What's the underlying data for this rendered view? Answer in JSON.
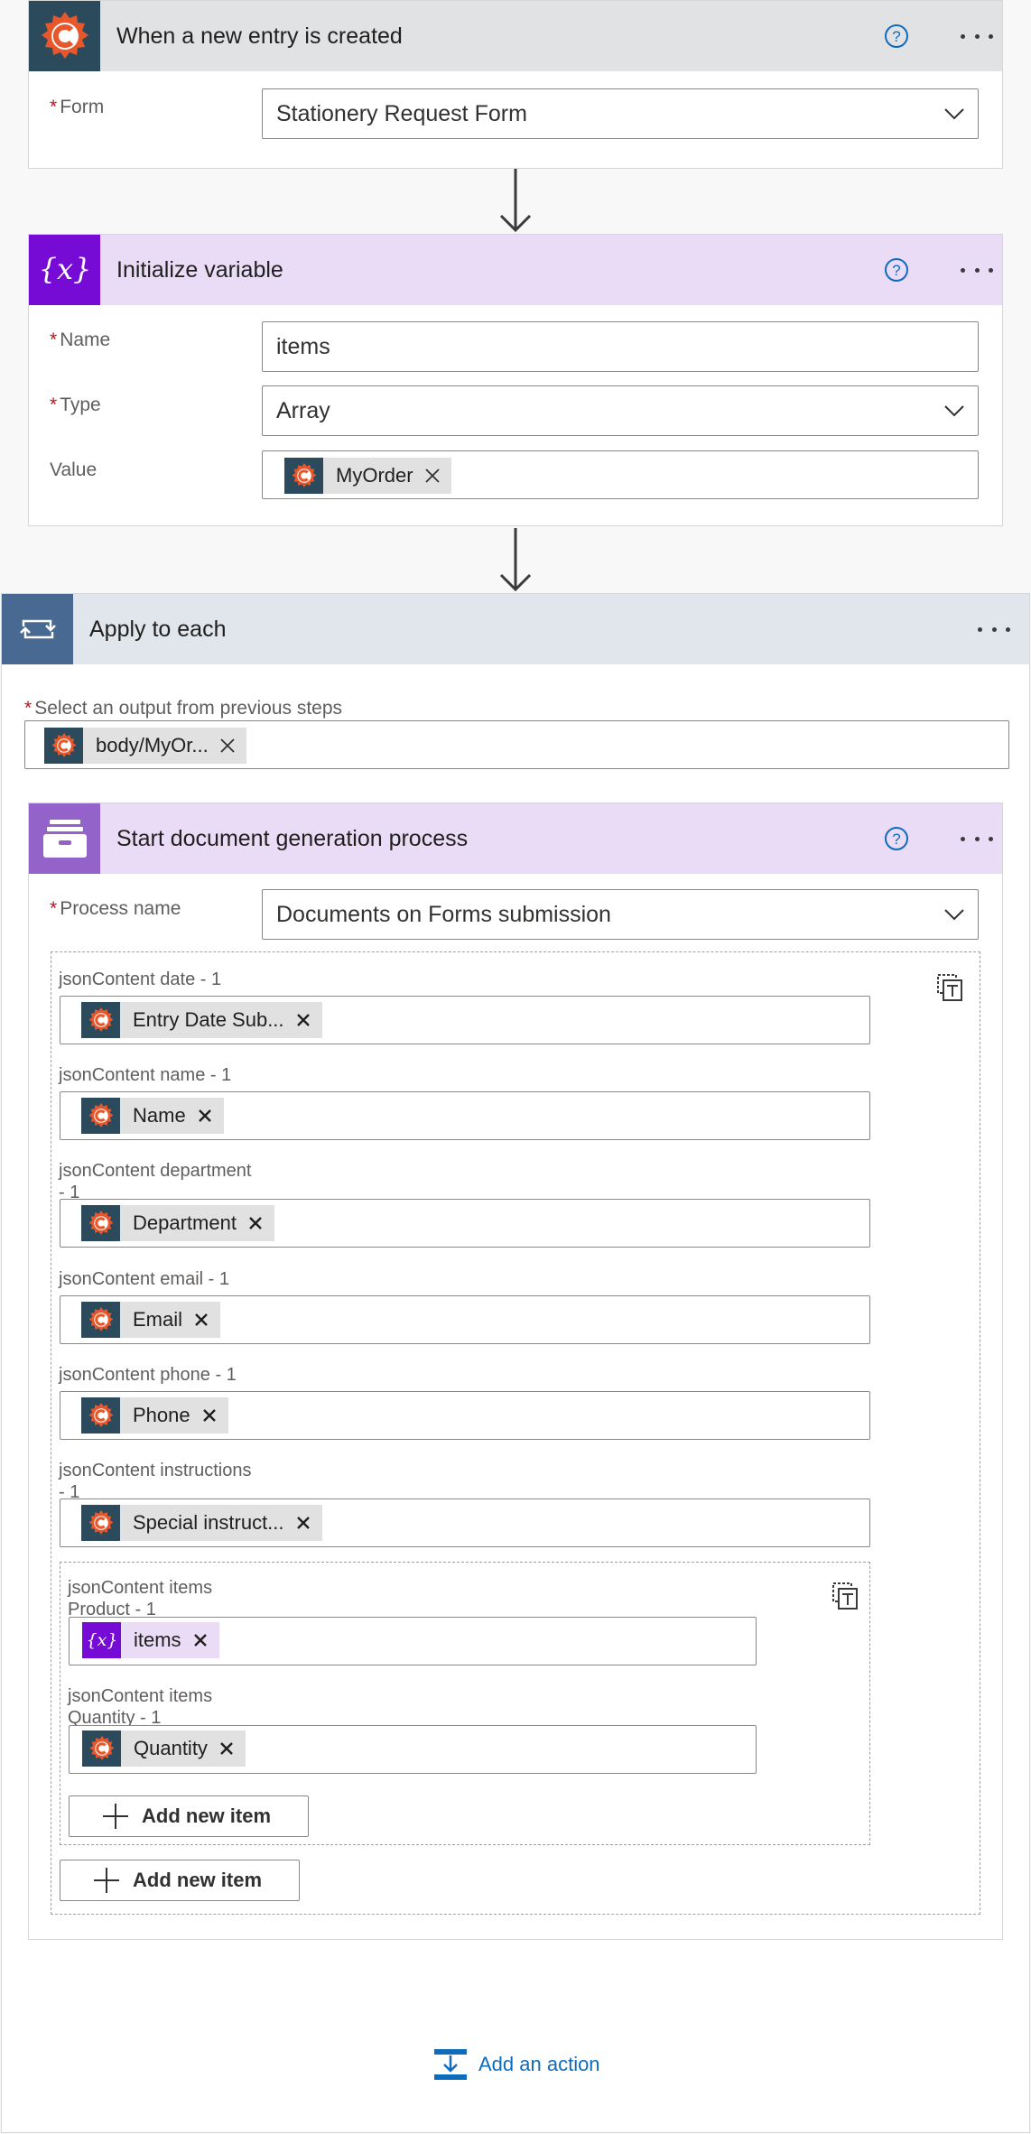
{
  "trigger": {
    "title": "When a new entry is created",
    "form_label": "Form",
    "form_value": "Stationery Request Form"
  },
  "init_variable": {
    "title": "Initialize variable",
    "name_label": "Name",
    "name_value": "items",
    "type_label": "Type",
    "type_value": "Array",
    "value_label": "Value",
    "value_token": "MyOrder"
  },
  "apply_each": {
    "title": "Apply to each",
    "select_label": "Select an output from previous steps",
    "select_token": "body/MyOr..."
  },
  "docgen": {
    "title": "Start document generation process",
    "process_label": "Process name",
    "process_value": "Documents on Forms submission",
    "fields": [
      {
        "label": "jsonContent date - 1",
        "token": "Entry Date Sub..."
      },
      {
        "label": "jsonContent name - 1",
        "token": "Name"
      },
      {
        "label": "jsonContent department",
        "label2": "- 1",
        "token": "Department"
      },
      {
        "label": "jsonContent email - 1",
        "token": "Email"
      },
      {
        "label": "jsonContent phone - 1",
        "token": "Phone"
      },
      {
        "label": "jsonContent instructions",
        "label2": "- 1",
        "token": "Special instruct..."
      }
    ],
    "items_fields": [
      {
        "label": "jsonContent items",
        "label2": "Product - 1",
        "token": "items"
      },
      {
        "label": "jsonContent items",
        "label2": "Quantity - 1",
        "token": "Quantity"
      }
    ],
    "add_new_item_inner": "Add new item",
    "add_new_item_outer": "Add new item"
  },
  "add_action": "Add an action",
  "colors": {
    "trigger_header": "#e1e2e4",
    "trigger_icon": "#2b4a5c",
    "variable_header": "#eadbf7",
    "variable_icon": "#770bd6",
    "loop_header": "#e1e6ed",
    "loop_icon": "#486991",
    "docgen_header": "#eadbf7",
    "docgen_icon": "#9463c9",
    "link": "#0f6cbd"
  },
  "icons": [
    "cognito-forms-icon",
    "variable-icon",
    "loop-icon",
    "document-generation-icon",
    "help-icon",
    "more-icon",
    "chevron-down-icon",
    "close-icon",
    "copy-icon",
    "plus-icon",
    "add-action-icon",
    "arrow-down-icon"
  ]
}
